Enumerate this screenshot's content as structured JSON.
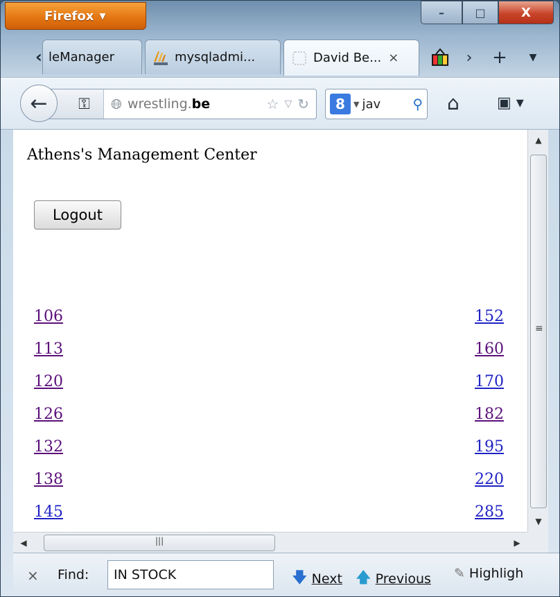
{
  "titlebar": {
    "app_button": "Firefox",
    "min": "–",
    "max": "□",
    "close": "X"
  },
  "tabs": [
    {
      "label": "leManager",
      "favicon": "none"
    },
    {
      "label": "mysqladmi...",
      "favicon": "phpmyadmin-icon"
    },
    {
      "label": "David Be...",
      "favicon": "blank-page-icon",
      "active": true,
      "close": "×"
    }
  ],
  "navbar": {
    "url_prefix": "wrestling.",
    "url_host": "be",
    "search_text": "jav"
  },
  "page": {
    "title": "Athens's Management Center",
    "logout_label": "Logout",
    "left_links": [
      "106",
      "113",
      "120",
      "126",
      "132",
      "138",
      "145"
    ],
    "right_links": [
      "152",
      "160",
      "170",
      "182",
      "195",
      "220",
      "285"
    ]
  },
  "findbar": {
    "label": "Find:",
    "value": "IN STOCK",
    "next": "Next",
    "previous": "Previous",
    "highlight": "Highligh"
  },
  "colors": {
    "visited_link": "#5a0f7a",
    "unvisited_link": "#1f22c4",
    "firefox_orange": "#e57713"
  }
}
